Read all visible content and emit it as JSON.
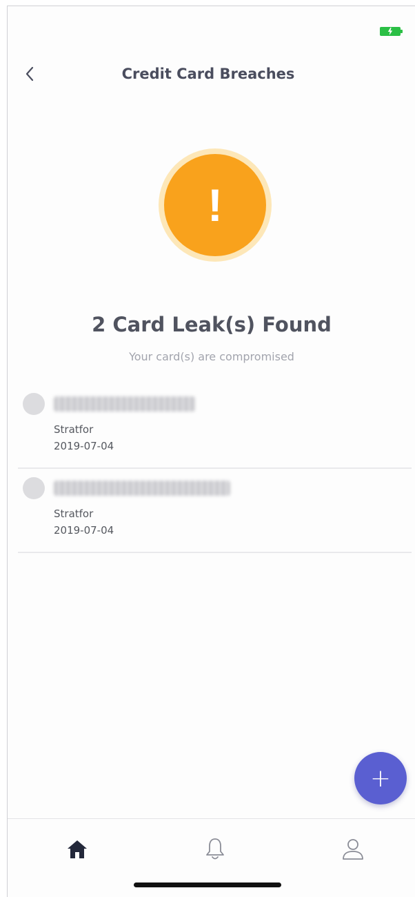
{
  "status_bar": {
    "battery_color": "#2bbf45"
  },
  "header": {
    "back_icon": "chevron-left-icon",
    "title": "Credit Card Breaches"
  },
  "alert": {
    "symbol": "!",
    "color": "#f9a21c",
    "headline": "2 Card Leak(s) Found",
    "subline": "Your card(s) are compromised"
  },
  "leaks": [
    {
      "card_number_state": "blurred",
      "source": "Stratfor",
      "date": "2019-07-04"
    },
    {
      "card_number_state": "blurred",
      "source": "Stratfor",
      "date": "2019-07-04"
    }
  ],
  "fab": {
    "label": "+",
    "color": "#5a5fd1"
  },
  "tab_bar": {
    "items": [
      {
        "icon": "home-icon",
        "active": true
      },
      {
        "icon": "bell-icon",
        "active": false
      },
      {
        "icon": "user-icon",
        "active": false
      }
    ]
  }
}
